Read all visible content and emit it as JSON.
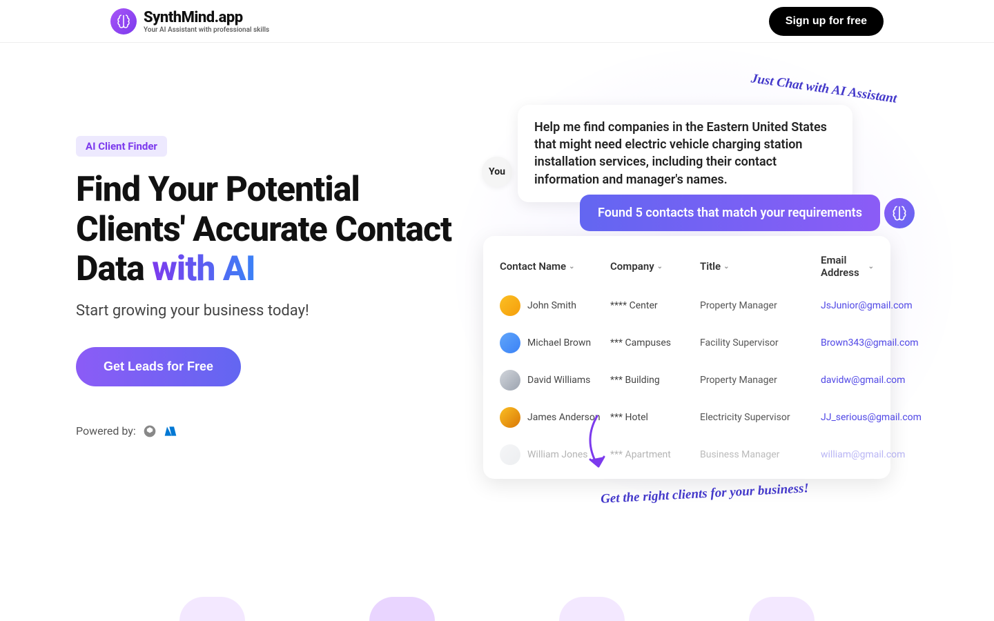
{
  "header": {
    "logo_title": "SynthMind.app",
    "logo_subtitle": "Your AI Assistant with professional skills",
    "signup_label": "Sign up for free"
  },
  "hero": {
    "badge": "AI Client Finder",
    "headline_part1": "Find Your Potential Clients' Accurate Contact Data ",
    "headline_accent": "with AI",
    "subheading": "Start growing your business today!",
    "cta_label": "Get Leads for Free",
    "powered_by_label": "Powered by:"
  },
  "chat": {
    "you_label": "You",
    "user_message": "Help me find companies in the Eastern United States that might need electric vehicle charging station installation services, including their contact information and manager's names.",
    "ai_response": "Found 5 contacts that match your requirements",
    "annotation_top": "Just Chat with AI Assistant",
    "annotation_bottom": "Get the right clients for your business!"
  },
  "table": {
    "headers": {
      "name": "Contact Name",
      "company": "Company",
      "title": "Title",
      "email": "Email Address"
    },
    "rows": [
      {
        "name": "John Smith",
        "company": "**** Center",
        "title": "Property Manager",
        "email": "JsJunior@gmail.com"
      },
      {
        "name": "Michael Brown",
        "company": "*** Campuses",
        "title": "Facility Supervisor",
        "email": "Brown343@gmail.com"
      },
      {
        "name": "David Williams",
        "company": "*** Building",
        "title": "Property Manager",
        "email": "davidw@gmail.com"
      },
      {
        "name": "James Anderson",
        "company": "*** Hotel",
        "title": "Electricity Supervisor",
        "email": "JJ_serious@gmail.com"
      },
      {
        "name": "William Jones",
        "company": "*** Apartment",
        "title": "Business Manager",
        "email": "william@gmail.com"
      }
    ]
  }
}
